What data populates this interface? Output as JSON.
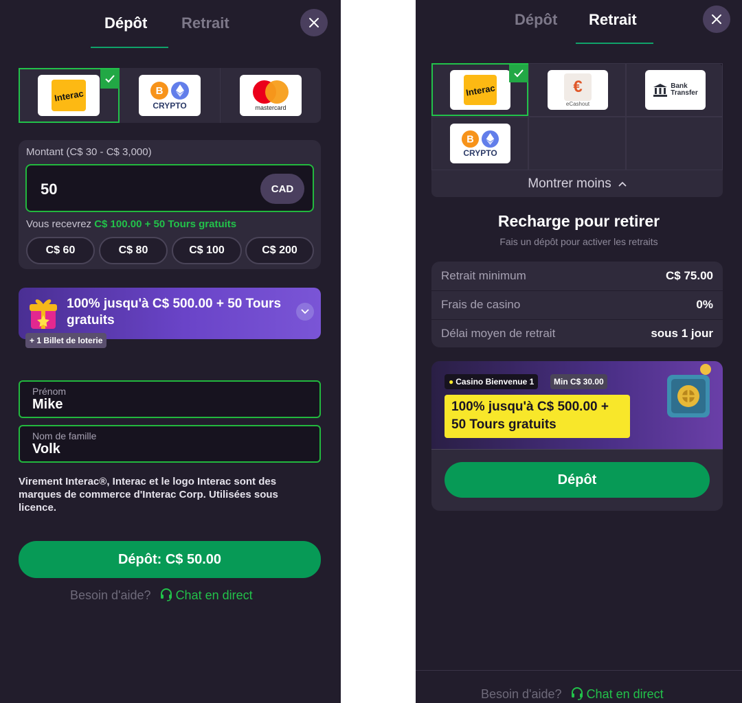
{
  "left": {
    "tabs": [
      {
        "label": "Dépôt"
      },
      {
        "label": "Retrait"
      }
    ],
    "methods": [
      {
        "name": "Interac",
        "logo_text": "Interac"
      },
      {
        "name": "Crypto",
        "logo_text": "CRYPTO"
      },
      {
        "name": "Mastercard",
        "logo_text": "mastercard"
      }
    ],
    "amount": {
      "label": "Montant (C$ 30 - C$ 3,000)",
      "value": "50",
      "currency": "CAD",
      "receive_prefix": "Vous recevrez",
      "receive_value": "C$ 100.00 + 50 Tours gratuits"
    },
    "presets": [
      "C$ 60",
      "C$ 80",
      "C$ 100",
      "C$ 200"
    ],
    "bonus": {
      "title": "100% jusqu'à C$ 500.00 + 50 Tours gratuits",
      "badge": "+ 1 Billet de loterie"
    },
    "first_name": {
      "label": "Prénom",
      "value": "Mike"
    },
    "last_name": {
      "label": "Nom de famille",
      "value": "Volk"
    },
    "disclaimer": "Virement Interac®, Interac et le logo Interac sont des marques de commerce d'Interac Corp. Utilisées sous licence.",
    "deposit_button": "Dépôt: C$ 50.00",
    "help_text": "Besoin d'aide?",
    "chat_text": "Chat en direct"
  },
  "right": {
    "tabs": [
      {
        "label": "Dépôt"
      },
      {
        "label": "Retrait"
      }
    ],
    "methods": [
      {
        "name": "Interac",
        "logo_text": "Interac"
      },
      {
        "name": "eCashout",
        "logo_text": "eCashout"
      },
      {
        "name": "Bank Transfer",
        "logo_text_1": "Bank",
        "logo_text_2": "Transfer"
      },
      {
        "name": "Crypto",
        "logo_text": "CRYPTO"
      }
    ],
    "show_less": "Montrer moins",
    "recharge_title": "Recharge pour retirer",
    "recharge_subtitle": "Fais un dépôt pour activer les retraits",
    "info_rows": [
      {
        "key": "Retrait minimum",
        "value": "C$ 75.00"
      },
      {
        "key": "Frais de casino",
        "value": "0%"
      },
      {
        "key": "Délai moyen de retrait",
        "value": "sous 1 jour"
      }
    ],
    "promo": {
      "tag1": "Casino Bienvenue 1",
      "tag2": "Min C$ 30.00",
      "title": "100% jusqu'à C$ 500.00 + 50 Tours gratuits"
    },
    "deposit_button": "Dépôt",
    "help_text": "Besoin d'aide?",
    "chat_text": "Chat en direct"
  },
  "colors": {
    "accent_green": "#079a56",
    "select_green": "#22c24a",
    "panel_bg": "#221d2c",
    "card_bg": "#2f2a3b",
    "promo_yellow": "#f8e72a"
  }
}
